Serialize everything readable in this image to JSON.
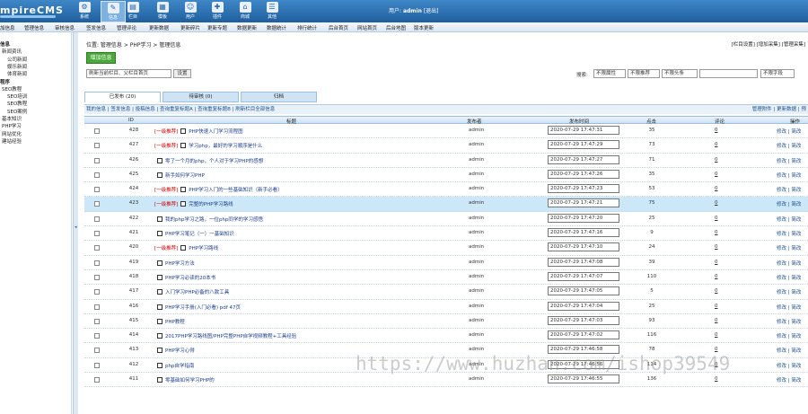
{
  "app": {
    "logo": "mpireCMS",
    "user_label": "用户:",
    "username": "admin",
    "logout": "[退出]"
  },
  "top_icons": [
    {
      "label": "系统",
      "icon": "system-icon"
    },
    {
      "label": "信息",
      "icon": "info-icon",
      "active": true
    },
    {
      "label": "栏目",
      "icon": "column-icon"
    },
    {
      "label": "模板",
      "icon": "template-icon"
    },
    {
      "label": "用户",
      "icon": "user-icon"
    },
    {
      "label": "插件",
      "icon": "plugin-icon"
    },
    {
      "label": "商城",
      "icon": "shop-icon"
    },
    {
      "label": "其他",
      "icon": "other-icon"
    }
  ],
  "subnav": [
    "加信息",
    "管理信息",
    "审核信息",
    "签发信息",
    "管理评论",
    "更新数据",
    "更新碎片",
    "更新专题",
    "数据更新",
    "数据统计",
    "排行统计",
    "后台首页",
    "网站首页",
    "后台地图",
    "版本更新"
  ],
  "sidebar": [
    {
      "label": "信息",
      "group": true
    },
    {
      "label": "新闻资讯",
      "group": false
    },
    {
      "label": "公司新闻",
      "group": false
    },
    {
      "label": "娱乐新闻",
      "group": false
    },
    {
      "label": "体育新闻",
      "group": false
    },
    {
      "label": "程序",
      "group": true
    },
    {
      "label": "SEO教程",
      "group": false
    },
    {
      "label": "SEO培训",
      "group": false
    },
    {
      "label": "SEO教程",
      "group": false
    },
    {
      "label": "SEO案例",
      "group": false
    },
    {
      "label": "基本知识",
      "group": false
    },
    {
      "label": "PHP学习",
      "group": false
    },
    {
      "label": "网站优化",
      "group": false
    },
    {
      "label": "建站经验",
      "group": false
    }
  ],
  "breadcrumb": "位置:  管理信息 > PHP学习 > 管理信息",
  "top_links": "[栏目设置] [增加采集] [管理采集]",
  "add_button": "增加信息",
  "column_select": "刷新当前栏目、父栏目首页",
  "set_button": "设置",
  "search": {
    "label": "搜索:",
    "filters": [
      "不限属性",
      "不限推荐",
      "不限头条",
      "不限字段"
    ],
    "placeholder": ""
  },
  "tabs": [
    "已发布 (20)",
    "待审核 (0)",
    "归档"
  ],
  "filter_left": "我的信息 | 签发信息 | 投稿信息 | 查询重复标题A | 查询重复标题B | 刷新栏目全部信息",
  "filter_right": "管理附件 | 更新数据 | 预",
  "columns": {
    "id": "ID",
    "title": "标题",
    "author": "发布者",
    "time": "发布时间",
    "clicks": "点击",
    "comments": "评论",
    "ops": "操作"
  },
  "rows": [
    {
      "id": "428",
      "tag": "[一级推荐]",
      "title": "PHP快速入门学习流程图",
      "author": "admin",
      "time": "2020-07-29 17:47:31",
      "clicks": "35",
      "comments": "0",
      "highlight": false
    },
    {
      "id": "427",
      "tag": "[一级推荐]",
      "title": "学习php，最好的学习顺序是什么",
      "author": "admin",
      "time": "2020-07-29 17:47:29",
      "clicks": "73",
      "comments": "0",
      "highlight": false
    },
    {
      "id": "426",
      "tag": "",
      "title": "零了一个月的php，个人对于学习PHP的感想",
      "author": "admin",
      "time": "2020-07-29 17:47:27",
      "clicks": "71",
      "comments": "0",
      "highlight": false
    },
    {
      "id": "425",
      "tag": "",
      "title": "新手如何学习PHP",
      "author": "admin",
      "time": "2020-07-29 17:47:26",
      "clicks": "35",
      "comments": "0",
      "highlight": false
    },
    {
      "id": "424",
      "tag": "[一级推荐]",
      "title": "PHP学习入门的一些基础知识（新手必看）",
      "author": "admin",
      "time": "2020-07-29 17:47:23",
      "clicks": "53",
      "comments": "0",
      "highlight": false
    },
    {
      "id": "423",
      "tag": "[一级推荐]",
      "title": "完整的PHP学习路线",
      "author": "admin",
      "time": "2020-07-29 17:47:21",
      "clicks": "75",
      "comments": "0",
      "highlight": true
    },
    {
      "id": "422",
      "tag": "",
      "title": "我的php学习之路，一位php同学的学习感悟",
      "author": "admin",
      "time": "2020-07-29 17:47:20",
      "clicks": "25",
      "comments": "0",
      "highlight": false
    },
    {
      "id": "421",
      "tag": "",
      "title": "PHP学习笔记（一）一基础知识",
      "author": "admin",
      "time": "2020-07-29 17:47:16",
      "clicks": "9",
      "comments": "0",
      "highlight": false
    },
    {
      "id": "420",
      "tag": "[一级推荐]",
      "title": "PHP学习路线",
      "author": "admin",
      "time": "2020-07-29 17:47:10",
      "clicks": "24",
      "comments": "0",
      "highlight": false
    },
    {
      "id": "419",
      "tag": "",
      "title": "PHP学习方法",
      "author": "admin",
      "time": "2020-07-29 17:47:08",
      "clicks": "39",
      "comments": "0",
      "highlight": false
    },
    {
      "id": "418",
      "tag": "",
      "title": "PHP学习必读的20本书",
      "author": "admin",
      "time": "2020-07-29 17:47:07",
      "clicks": "110",
      "comments": "0",
      "highlight": false
    },
    {
      "id": "417",
      "tag": "",
      "title": "入门学习PHP必备的八款工具",
      "author": "admin",
      "time": "2020-07-29 17:47:05",
      "clicks": "5",
      "comments": "0",
      "highlight": false
    },
    {
      "id": "416",
      "tag": "",
      "title": "PHP学习手册(入门必看) pdf 47页",
      "author": "admin",
      "time": "2020-07-29 17:47:04",
      "clicks": "25",
      "comments": "0",
      "highlight": false
    },
    {
      "id": "415",
      "tag": "",
      "title": "PHP教程",
      "author": "admin",
      "time": "2020-07-29 17:47:03",
      "clicks": "93",
      "comments": "0",
      "highlight": false
    },
    {
      "id": "414",
      "tag": "",
      "title": "2017PHP学习路线图/PHP完整PHP自学视频教程+工具经验",
      "author": "admin",
      "time": "2020-07-29 17:47:02",
      "clicks": "116",
      "comments": "0",
      "highlight": false
    },
    {
      "id": "413",
      "tag": "",
      "title": "PHP学习心得",
      "author": "admin",
      "time": "2020-07-29 17:46:58",
      "clicks": "78",
      "comments": "0",
      "highlight": false
    },
    {
      "id": "412",
      "tag": "",
      "title": "php自学指南",
      "author": "admin",
      "time": "2020-07-29 17:46:56",
      "clicks": "114",
      "comments": "0",
      "highlight": false
    },
    {
      "id": "411",
      "tag": "",
      "title": "零基础如何学习PHP的",
      "author": "admin",
      "time": "2020-07-29 17:46:55",
      "clicks": "136",
      "comments": "0",
      "highlight": false
    }
  ],
  "row_ops": "修改 | 简改",
  "watermark": "https://www.huzhan.com/ishop39549"
}
